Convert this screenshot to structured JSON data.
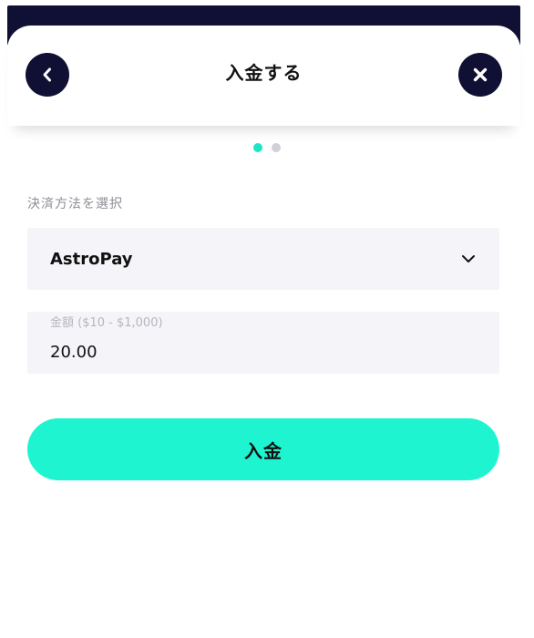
{
  "header": {
    "title": "入金する",
    "back_icon": "chevron-left-icon",
    "close_icon": "close-icon"
  },
  "pagination": {
    "total": 2,
    "active": 1
  },
  "payment_method": {
    "label": "決済方法を選択",
    "selected": "AstroPay",
    "dropdown_icon": "chevron-down-icon"
  },
  "amount": {
    "label": "金額 ($10 - $1,000)",
    "value": "20.00"
  },
  "deposit_button": {
    "label": "入金"
  },
  "colors": {
    "navy": "#0f1033",
    "accent": "#1ef5d0",
    "dot_active": "#1ee5c8",
    "dot_inactive": "#d0d0d6",
    "field_bg": "#f5f5f9"
  }
}
